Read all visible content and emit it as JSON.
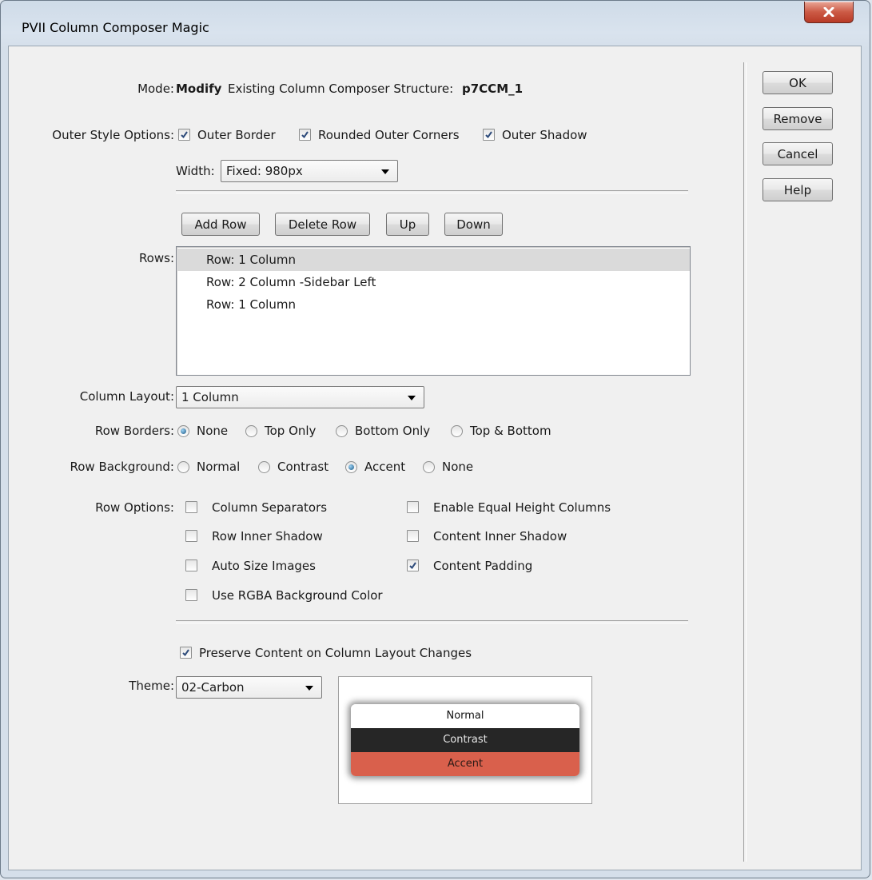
{
  "window": {
    "title": "PVII Column Composer Magic"
  },
  "mode": {
    "label": "Mode:",
    "action": "Modify",
    "text": "Existing Column Composer Structure:",
    "structure_id": "p7CCM_1"
  },
  "outer_style": {
    "label": "Outer Style Options:",
    "options": [
      {
        "label": "Outer Border",
        "checked": true
      },
      {
        "label": "Rounded Outer Corners",
        "checked": true
      },
      {
        "label": "Outer Shadow",
        "checked": true
      }
    ],
    "width_label": "Width:",
    "width_value": "Fixed: 980px"
  },
  "row_buttons": {
    "add": "Add Row",
    "delete": "Delete Row",
    "up": "Up",
    "down": "Down"
  },
  "rows": {
    "label": "Rows:",
    "items": [
      "Row: 1 Column",
      "Row: 2 Column -Sidebar Left",
      "Row: 1 Column"
    ],
    "selected_index": 0
  },
  "column_layout": {
    "label": "Column Layout:",
    "value": "1 Column"
  },
  "row_borders": {
    "label": "Row Borders:",
    "options": [
      "None",
      "Top Only",
      "Bottom Only",
      "Top & Bottom"
    ],
    "selected": "None"
  },
  "row_background": {
    "label": "Row Background:",
    "options": [
      "Normal",
      "Contrast",
      "Accent",
      "None"
    ],
    "selected": "Accent"
  },
  "row_options": {
    "label": "Row Options:",
    "left": [
      {
        "label": "Column Separators",
        "checked": false
      },
      {
        "label": "Row Inner Shadow",
        "checked": false
      },
      {
        "label": "Auto Size Images",
        "checked": false
      },
      {
        "label": "Use RGBA Background Color",
        "checked": false
      }
    ],
    "right": [
      {
        "label": "Enable Equal Height Columns",
        "checked": false
      },
      {
        "label": "Content Inner Shadow",
        "checked": false
      },
      {
        "label": "Content Padding",
        "checked": true
      }
    ]
  },
  "preserve": {
    "label": "Preserve Content on Column Layout Changes",
    "checked": true
  },
  "theme": {
    "label": "Theme:",
    "value": "02-Carbon",
    "preview": {
      "normal": "Normal",
      "contrast": "Contrast",
      "accent": "Accent"
    },
    "colors": {
      "normal_bg": "#ffffff",
      "contrast_bg": "#262626",
      "accent_bg": "#d9604c"
    }
  },
  "side_buttons": {
    "ok": "OK",
    "remove": "Remove",
    "cancel": "Cancel",
    "help": "Help"
  },
  "icons": {
    "close": "close-icon",
    "check": "checkmark-icon",
    "dropdown": "chevron-down-icon"
  }
}
